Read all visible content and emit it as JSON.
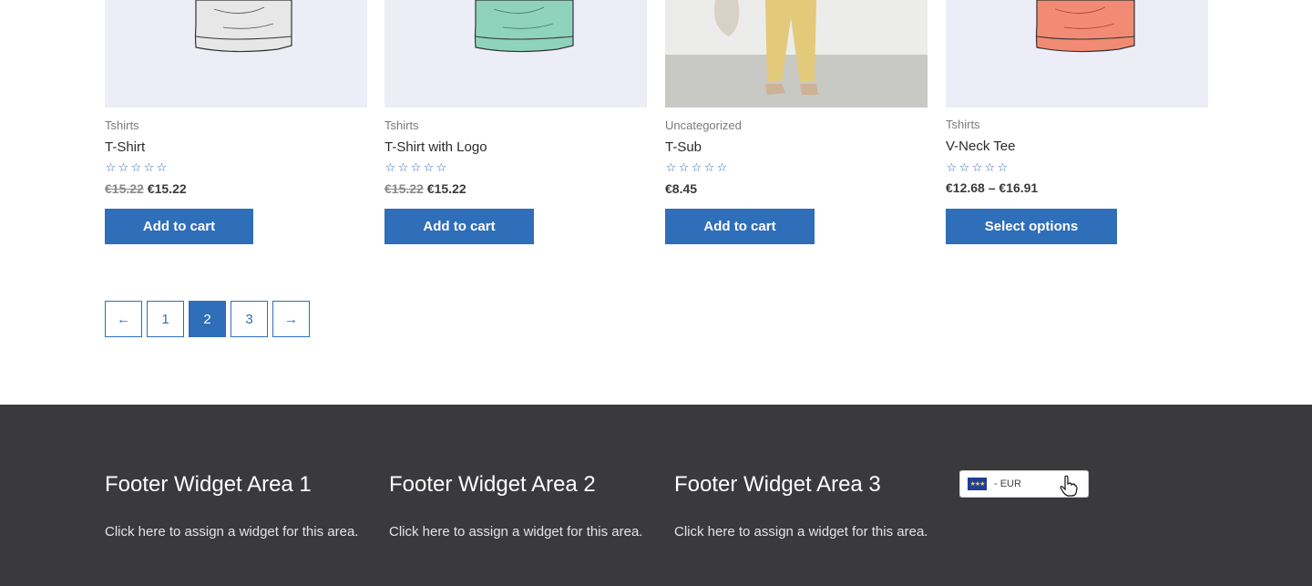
{
  "products": [
    {
      "category": "Tshirts",
      "title": "T-Shirt",
      "old_price": "€15.22",
      "price": "€15.22",
      "button": "Add to cart",
      "image": "grey-tshirt-sketch"
    },
    {
      "category": "Tshirts",
      "title": "T-Shirt with Logo",
      "old_price": "€15.22",
      "price": "€15.22",
      "button": "Add to cart",
      "image": "mint-tshirt-sketch"
    },
    {
      "category": "Uncategorized",
      "title": "T-Sub",
      "old_price": "",
      "price": "€8.45",
      "button": "Add to cart",
      "image": "yellow-trousers-photo"
    },
    {
      "category": "Tshirts",
      "title": "V-Neck Tee",
      "old_price": "",
      "price": "€12.68 – €16.91",
      "button": "Select options",
      "image": "coral-tshirt-sketch"
    }
  ],
  "pagination": {
    "prev": "←",
    "pages": [
      "1",
      "2",
      "3"
    ],
    "current": "2",
    "next": "→"
  },
  "footer": {
    "widgets": [
      {
        "title": "Footer Widget Area 1",
        "text": "Click here to assign a widget for this area."
      },
      {
        "title": "Footer Widget Area 2",
        "text": "Click here to assign a widget for this area."
      },
      {
        "title": "Footer Widget Area 3",
        "text": "Click here to assign a widget for this area."
      }
    ],
    "currency": {
      "label": "- EUR",
      "flag": "eu-flag-icon"
    }
  },
  "colors": {
    "accent": "#2f6eb8",
    "footer_bg": "#3a3a3c",
    "thumb_bg": "#ecedf7"
  }
}
